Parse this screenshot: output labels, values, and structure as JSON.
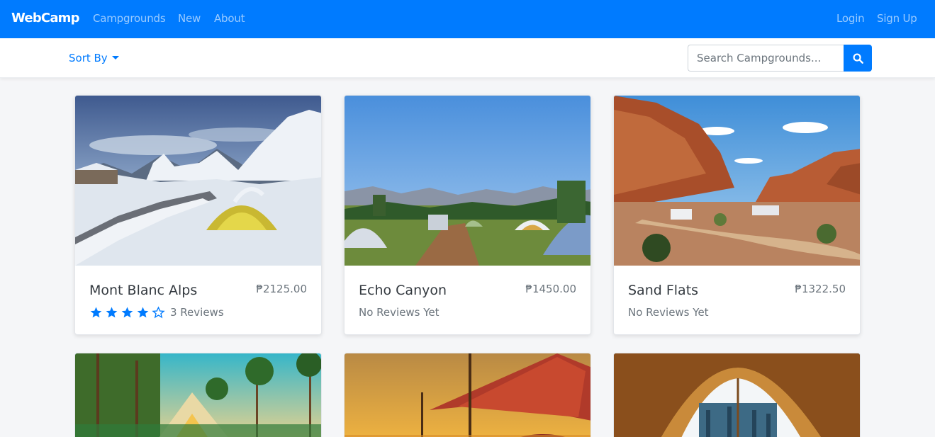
{
  "navbar": {
    "brand": "WebCamp",
    "links": [
      "Campgrounds",
      "New",
      "About"
    ],
    "login": "Login",
    "signup": "Sign Up",
    "color": "#007bff"
  },
  "toolbar": {
    "sort_label": "Sort By",
    "search_placeholder": "Search Campgrounds..."
  },
  "campgrounds": [
    {
      "name": "Mont Blanc Alps",
      "price": "₱2125.00",
      "rating": 4,
      "max_rating": 5,
      "reviews": "3 Reviews"
    },
    {
      "name": "Echo Canyon",
      "price": "₱1450.00",
      "reviews": "No Reviews Yet"
    },
    {
      "name": "Sand Flats",
      "price": "₱1322.50",
      "reviews": "No Reviews Yet"
    }
  ],
  "icons": {
    "search": "search-icon",
    "caret": "caret-down-icon",
    "star_filled": "star-filled-icon",
    "star_empty": "star-empty-icon"
  }
}
